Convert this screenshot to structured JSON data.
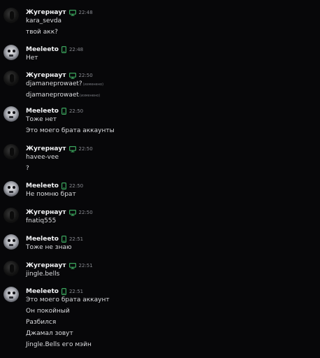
{
  "messages": [
    {
      "author": "Жугернаут",
      "device": "desktop",
      "time": "22:48",
      "avatar": "dark",
      "lines": [
        {
          "text": "kara_sevda"
        },
        {
          "text": "твой акк?"
        }
      ]
    },
    {
      "author": "Meeleeto",
      "device": "mobile",
      "time": "22:48",
      "avatar": "light",
      "lines": [
        {
          "text": "Нет"
        }
      ]
    },
    {
      "author": "Жугернаут",
      "device": "desktop",
      "time": "22:50",
      "avatar": "dark",
      "lines": [
        {
          "text": "djamaneprowaet?",
          "edited": "(изменено)"
        },
        {
          "text": "djamaneprowaet",
          "edited": "(изменено)"
        }
      ]
    },
    {
      "author": "Meeleeto",
      "device": "mobile",
      "time": "22:50",
      "avatar": "light",
      "lines": [
        {
          "text": "Тоже нет"
        },
        {
          "text": "Это моего брата аккаунты"
        }
      ]
    },
    {
      "author": "Жугернаут",
      "device": "desktop",
      "time": "22:50",
      "avatar": "dark",
      "lines": [
        {
          "text": "havee-vee"
        },
        {
          "text": "?"
        }
      ]
    },
    {
      "author": "Meeleeto",
      "device": "mobile",
      "time": "22:50",
      "avatar": "light",
      "lines": [
        {
          "text": "Не помню брат"
        }
      ]
    },
    {
      "author": "Жугернаут",
      "device": "desktop",
      "time": "22:50",
      "avatar": "dark",
      "lines": [
        {
          "text": "fnatiq555"
        }
      ]
    },
    {
      "author": "Meeleeto",
      "device": "mobile",
      "time": "22:51",
      "avatar": "light",
      "lines": [
        {
          "text": "Тоже не знаю"
        }
      ]
    },
    {
      "author": "Жугернаут",
      "device": "desktop",
      "time": "22:51",
      "avatar": "dark",
      "lines": [
        {
          "text": "jingle.bells"
        }
      ]
    },
    {
      "author": "Meeleeto",
      "device": "mobile",
      "time": "22:51",
      "avatar": "light",
      "lines": [
        {
          "text": "Это моего брата аккаунт"
        },
        {
          "text": "Он покойный"
        },
        {
          "text": "Разбился"
        },
        {
          "text": "Джамал зовут"
        },
        {
          "text": "Jingle.Bells его мэйн"
        }
      ]
    }
  ],
  "colors": {
    "background": "#070709",
    "status_green": "#3ba55d",
    "name": "#f2f3f5",
    "timestamp": "#8b8d93"
  },
  "icons": {
    "desktop": "monitor-icon",
    "mobile": "phone-icon"
  }
}
